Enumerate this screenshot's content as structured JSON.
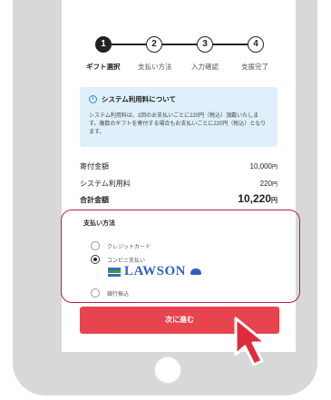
{
  "stepper": {
    "steps": [
      {
        "number": "1",
        "label": "ギフト選択",
        "active": true
      },
      {
        "number": "2",
        "label": "支払い方法",
        "active": false
      },
      {
        "number": "3",
        "label": "入力確認",
        "active": false
      },
      {
        "number": "4",
        "label": "支援完了",
        "active": false
      }
    ]
  },
  "info": {
    "icon": "info-icon",
    "title": "システム利用料について",
    "body": "システム利用料は、1回のお支払いごとに220円（税込）頂戴いたします。複数のギフトを寄付する場合もお支払いごとに220円（税込）となります。"
  },
  "fees": {
    "donation_label": "寄付金額",
    "donation_value": "10,000",
    "system_label": "システム利用料",
    "system_value": "220",
    "total_label": "合計金額",
    "total_value": "10,220",
    "unit": "円"
  },
  "payment": {
    "title": "支払い方法",
    "options": [
      {
        "label": "クレジットカード",
        "selected": false
      },
      {
        "label": "コンビニ支払い",
        "selected": true
      },
      {
        "label": "銀行振込",
        "selected": false
      }
    ],
    "store_brand": "LAWSON"
  },
  "next_button_label": "次に進む",
  "colors": {
    "accent": "#e8444f",
    "highlight_outline": "#b3233a",
    "info_background": "#dff0fb",
    "cursor": "#e02b3b"
  }
}
